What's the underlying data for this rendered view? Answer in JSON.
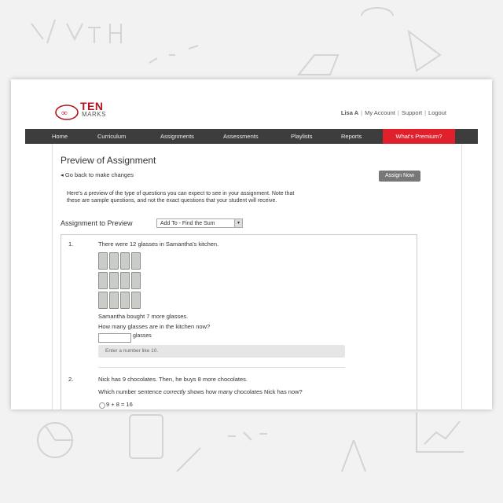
{
  "header": {
    "logo_ten": "TEN",
    "logo_marks": "MARKS",
    "user": "Lisa A",
    "links": [
      "My Account",
      "Support",
      "Logout"
    ]
  },
  "nav": {
    "items": [
      "Home",
      "Curriculum",
      "Assignments",
      "Assessments",
      "Playlists",
      "Reports"
    ],
    "active_item": "What's Premium?"
  },
  "page": {
    "title": "Preview of Assignment",
    "back_link": "Go back to make changes",
    "assign_button": "Assign Now",
    "intro": "Here's a preview of the type of questions you can expect to see in your assignment. Note that these are sample questions, and not the exact questions that your student will receive.",
    "assignment_label": "Assignment to Preview",
    "assignment_select": "Add To - Find the Sum"
  },
  "questions": [
    {
      "number": "1.",
      "text": "There were 12 glasses in Samantha's kitchen.",
      "text2": "Samantha bought 7 more glasses.",
      "text3": "How many glasses are in the kitchen now?",
      "unit": "glasses",
      "hint": "Enter a number like 10."
    },
    {
      "number": "2.",
      "text": "Nick has 9 chocolates. Then, he buys 8 more chocolates.",
      "text2_pre": "Which number sentence ",
      "text2_em": "correctly",
      "text2_post": " shows how many chocolates Nick has now?",
      "option": "9 + 8 = 16"
    }
  ],
  "colors": {
    "brand_red": "#b5121b",
    "nav_bg": "#3d3d3d",
    "nav_active": "#e0202a"
  }
}
